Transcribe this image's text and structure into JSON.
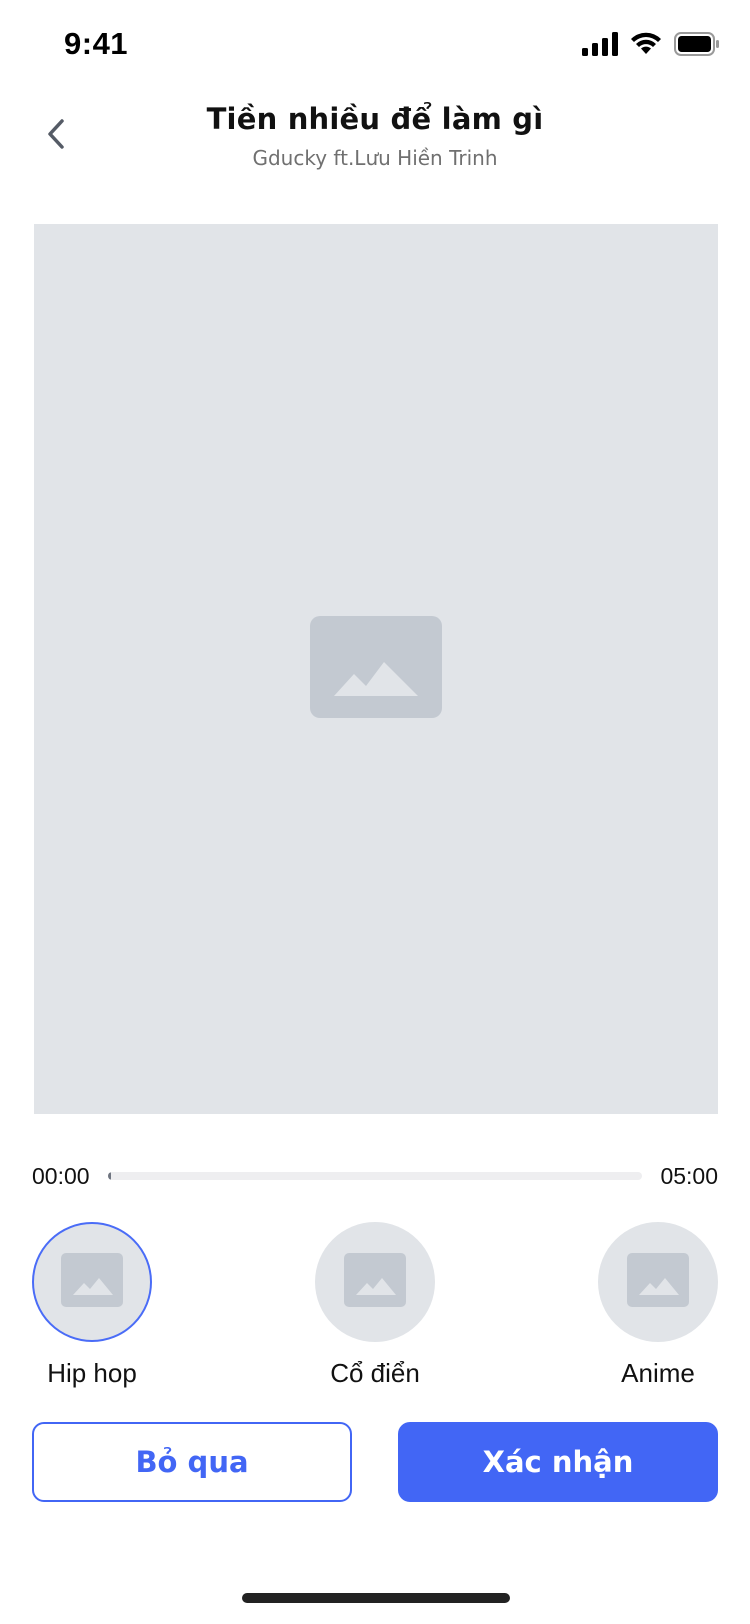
{
  "status_bar": {
    "time": "9:41",
    "icons": [
      "signal-icon",
      "wifi-icon",
      "battery-icon"
    ]
  },
  "header": {
    "back_icon": "chevron-left-icon",
    "title": "Tiền nhiều để làm gì",
    "subtitle": "Gducky ft.Lưu Hiền Trinh"
  },
  "preview": {
    "icon": "image-placeholder-icon"
  },
  "player": {
    "current_time": "00:00",
    "total_time": "05:00",
    "progress_percent": 0.5
  },
  "styles": [
    {
      "label": "Hip hop",
      "selected": true
    },
    {
      "label": "Cổ điển",
      "selected": false
    },
    {
      "label": "Anime",
      "selected": false
    }
  ],
  "actions": {
    "skip_label": "Bỏ qua",
    "confirm_label": "Xác nhận"
  },
  "colors": {
    "accent": "#4266f5",
    "placeholder_bg": "#e1e4e8",
    "placeholder_icon": "#c3c9d1"
  }
}
